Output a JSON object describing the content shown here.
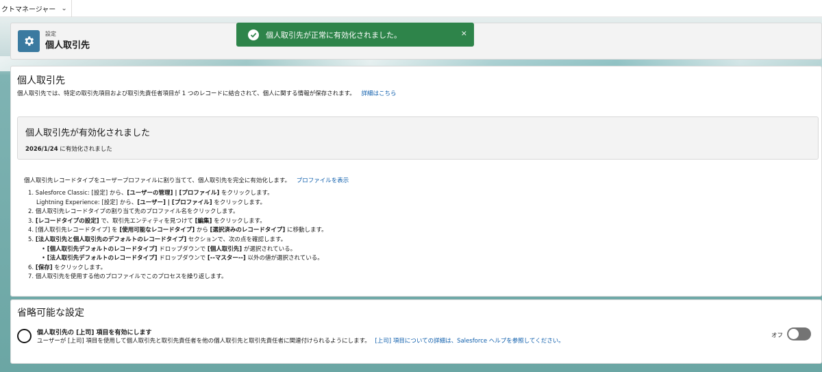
{
  "app": {
    "name": "クトマネージャー"
  },
  "header": {
    "kicker": "設定",
    "title": "個人取引先"
  },
  "toast": {
    "message": "個人取引先が正常に有効化されました。",
    "close": "×"
  },
  "main": {
    "title": "個人取引先",
    "intro": "個人取引先では、特定の取引先項目および取引先責任者項目が 1 つのレコードに結合されて、個人に関する情報が保存されます。",
    "intro_link": "詳細はこちら",
    "status": {
      "title": "個人取引先が有効化されました",
      "date": "2026/1/24",
      "date_suffix": " に有効化されました"
    },
    "assign_text": "個人取引先レコードタイプをユーザープロファイルに割り当てて、個人取引先を完全に有効化します。",
    "assign_link": "プロファイルを表示",
    "steps": {
      "s1a_pre": "1. Salesforce Classic: [設定] から、",
      "s1a_bold": "[ユーザーの管理] | [プロファイル]",
      "s1a_post": " をクリックします。",
      "s1b_pre": "Lightning Experience: [設定] から、",
      "s1b_bold": "[ユーザー] | [プロファイル]",
      "s1b_post": " をクリックします。",
      "s2": "2. 個人取引先レコードタイプの割り当て先のプロファイル名をクリックします。",
      "s3_pre": "3. ",
      "s3_bold1": "[レコードタイプの設定]",
      "s3_mid": " で、取引先エンティティを見つけて ",
      "s3_bold2": "[編集]",
      "s3_post": " をクリックします。",
      "s4_pre": "4. [個人取引先レコードタイプ] を ",
      "s4_bold1": "[使用可能なレコードタイプ]",
      "s4_mid": " から ",
      "s4_bold2": "[選択済みのレコードタイプ]",
      "s4_post": " に移動します。",
      "s5_pre": "5. ",
      "s5_bold": "[法人取引先と個人取引先のデフォルトのレコードタイプ]",
      "s5_post": " セクションで、次の点を確認します。",
      "s5a_bullet": "•",
      "s5a_bold1": "[個人取引先デフォルトのレコードタイプ]",
      "s5a_mid": " ドロップダウンで ",
      "s5a_bold2": "[個人取引先]",
      "s5a_post": " が選択されている。",
      "s5b_bullet": "•",
      "s5b_bold1": "[法人取引先デフォルトのレコードタイプ]",
      "s5b_mid": " ドロップダウンで ",
      "s5b_bold2": "[--マスター--]",
      "s5b_post": " 以外の値が選択されている。",
      "s6_pre": "6. ",
      "s6_bold": "[保存]",
      "s6_post": " をクリックします。",
      "s7": "7. 個人取引先を使用する他のプロファイルでこのプロセスを繰り返します。"
    }
  },
  "optional": {
    "title": "省略可能な設定",
    "item_name": "個人取引先の [上司] 項目を有効にします",
    "item_desc": "ユーザーが [上司] 項目を使用して個人取引先と取引先責任者を他の個人取引先と取引先責任者に関連付けられるようにします。",
    "item_link": "[上司] 項目についての詳細は、Salesforce ヘルプを参照してください。",
    "toggle_label": "オフ",
    "toggle_on": false
  },
  "colors": {
    "brand": "#3b7aa0",
    "toast": "#2e844a",
    "link": "#0b5cab",
    "backdrop": "#6ba6a4"
  },
  "icons": [
    "chevron-down-icon",
    "gear-icon",
    "check-icon",
    "close-icon",
    "radio-icon"
  ]
}
